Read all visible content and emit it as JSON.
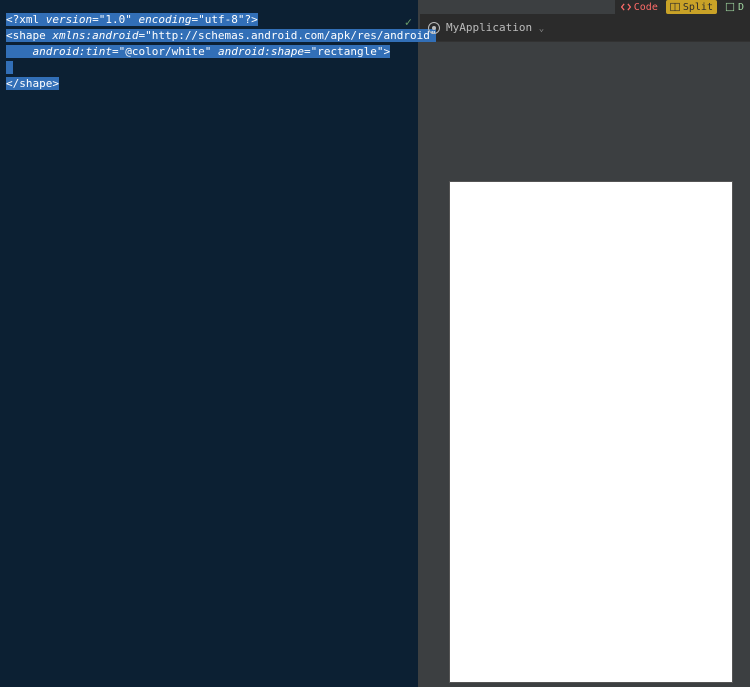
{
  "topbar": {
    "code_label": "Code",
    "split_label": "Split",
    "design_label": "D"
  },
  "editor": {
    "lines": {
      "l1_a": "<?xml ",
      "l1_b_attr": "version",
      "l1_b_eq": "=",
      "l1_b_val": "\"1.0\"",
      "l1_c_attr": " encoding",
      "l1_c_val": "\"utf-8\"",
      "l1_end": "?>",
      "l2_a": "<shape ",
      "l2_b_attr": "xmlns:android",
      "l2_b_eq": "=",
      "l2_b_val": "\"http://schemas.android.com/apk/res/android\"",
      "l3_indent": "    ",
      "l3_a_attr": "android:tint",
      "l3_a_eq": "=",
      "l3_a_val": "\"@color/white\"",
      "l3_b_attr": " android:shape",
      "l3_b_eq": "=",
      "l3_b_val": "\"rectangle\"",
      "l3_end": ">",
      "l5": "</shape>"
    },
    "status_ok": "✓"
  },
  "preview": {
    "app_name": "MyApplication",
    "chevron": "⌄"
  }
}
